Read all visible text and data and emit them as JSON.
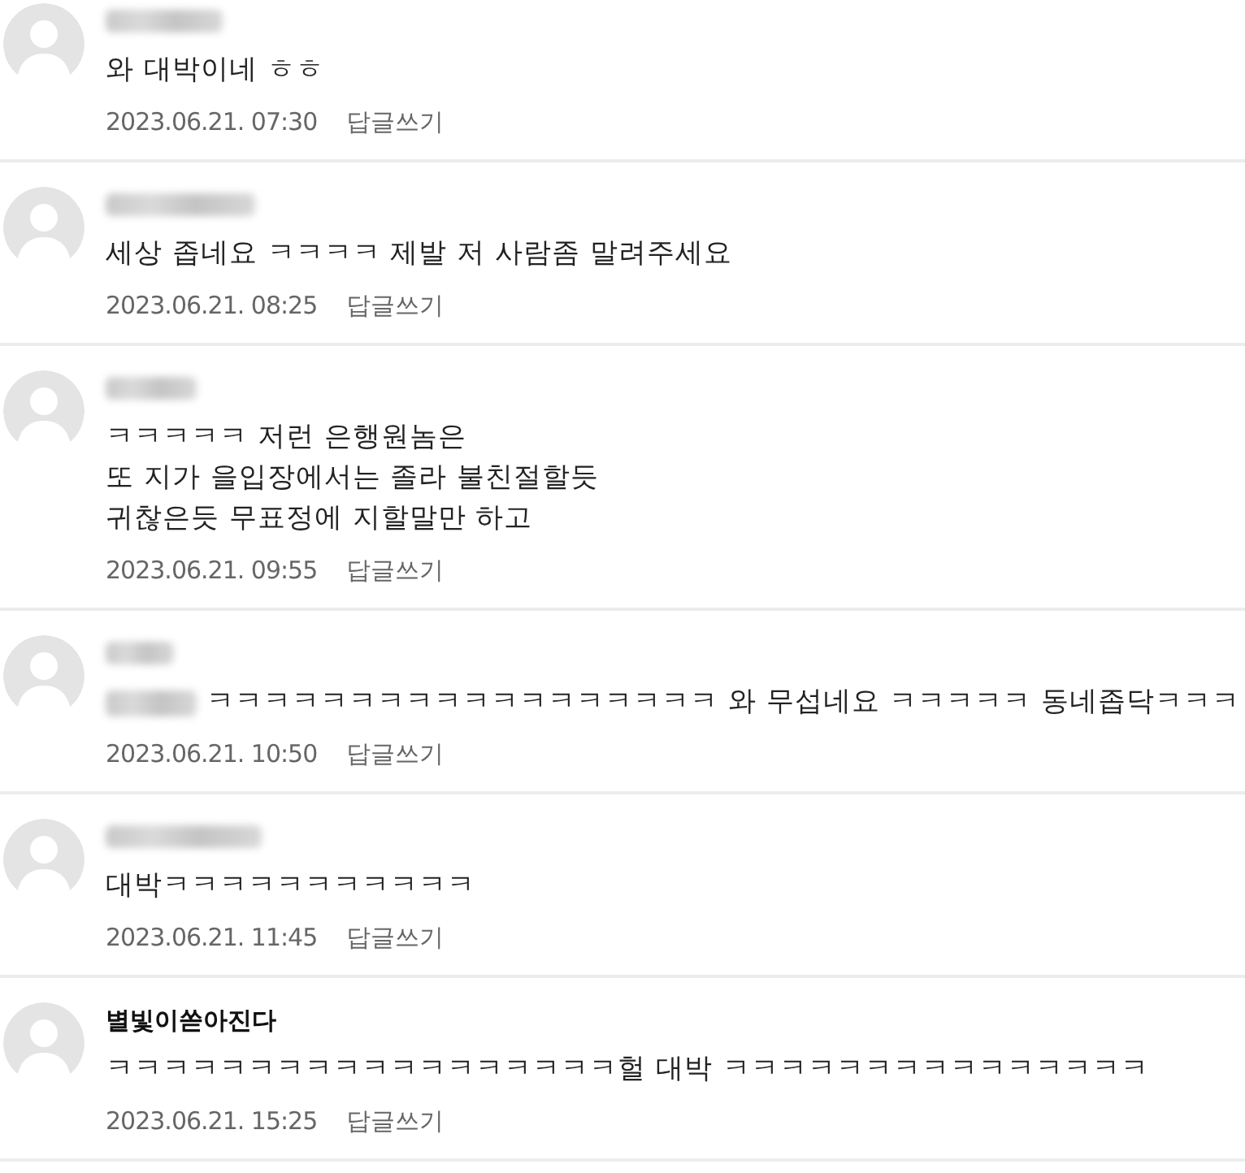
{
  "comments": [
    {
      "author_redacted": true,
      "text": "와 대박이네 ㅎㅎ",
      "date": "2023.06.21. 07:30",
      "reply_label": "답글쓰기"
    },
    {
      "author_redacted": true,
      "text": "세상 좁네요 ㅋㅋㅋㅋ 제발 저 사람좀 말려주세요",
      "date": "2023.06.21. 08:25",
      "reply_label": "답글쓰기"
    },
    {
      "author_redacted": true,
      "text": "ㅋㅋㅋㅋㅋ 저런 은행원놈은\n또 지가 을입장에서는 졸라 불친절할듯\n귀찮은듯 무표정에 지할말만 하고",
      "date": "2023.06.21. 09:55",
      "reply_label": "답글쓰기"
    },
    {
      "author_redacted": true,
      "reply_to_redacted": true,
      "text": "ㅋㅋㅋㅋㅋㅋㅋㅋㅋㅋㅋㅋㅋㅋㅋㅋㅋㅋ 와 무섭네요 ㅋㅋㅋㅋㅋ 동네좁닥ㅋㅋㅋ",
      "date": "2023.06.21. 10:50",
      "reply_label": "답글쓰기"
    },
    {
      "author_redacted": true,
      "text": "대박ㅋㅋㅋㅋㅋㅋㅋㅋㅋㅋㅋ",
      "date": "2023.06.21. 11:45",
      "reply_label": "답글쓰기"
    },
    {
      "author_redacted": false,
      "author": "별빛이쏟아진다",
      "text": "ㅋㅋㅋㅋㅋㅋㅋㅋㅋㅋㅋㅋㅋㅋㅋㅋㅋㅋ헐 대박 ㅋㅋㅋㅋㅋㅋㅋㅋㅋㅋㅋㅋㅋㅋㅋ",
      "date": "2023.06.21. 15:25",
      "reply_label": "답글쓰기"
    }
  ]
}
